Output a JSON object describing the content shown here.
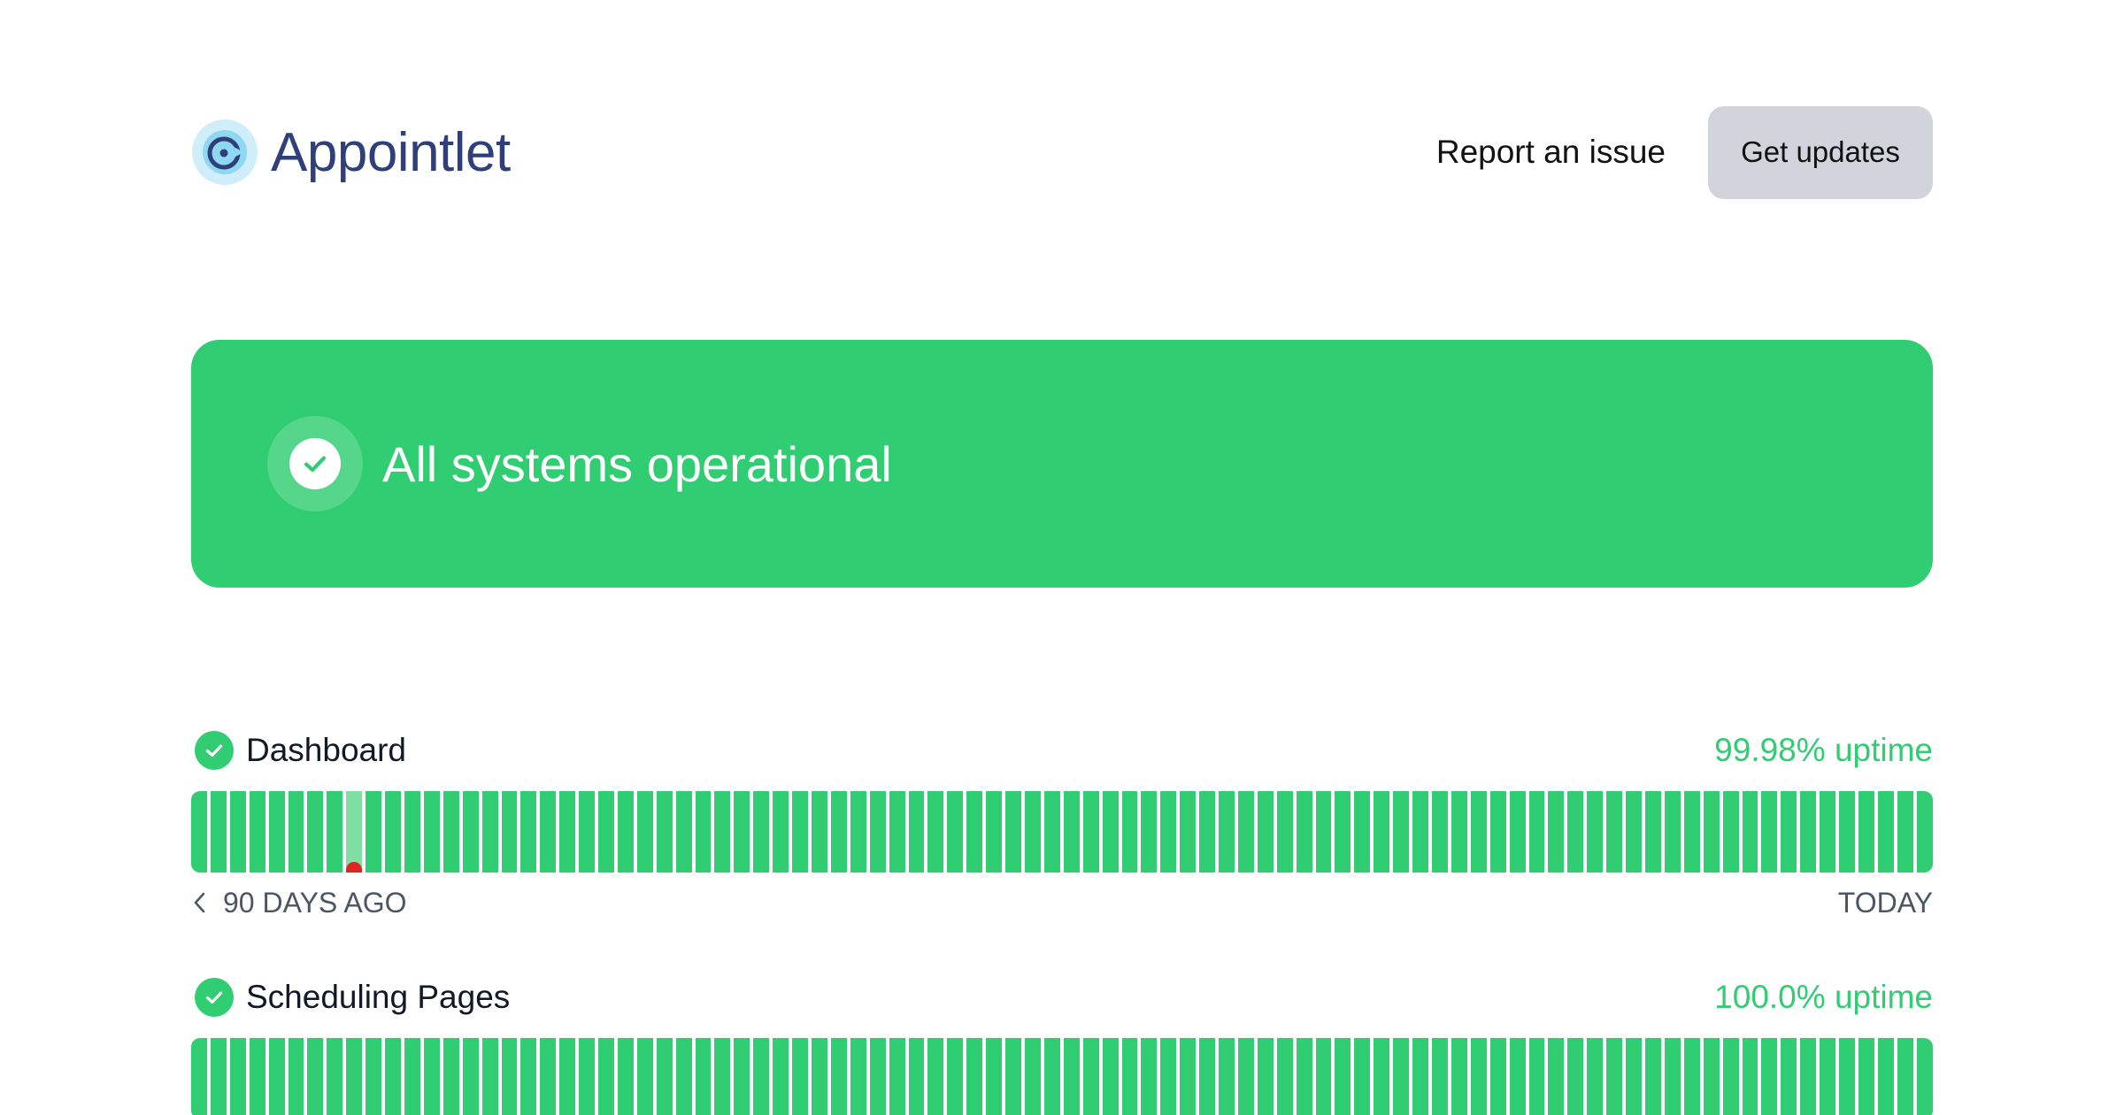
{
  "header": {
    "logo_text": "Appointlet",
    "report_label": "Report an issue",
    "updates_label": "Get updates"
  },
  "banner": {
    "status_text": "All systems operational",
    "color": "#30cd72"
  },
  "colors": {
    "operational": "#30cd72",
    "degraded": "#7fdea4",
    "outage_marker": "#dc2626",
    "button_bg": "#d1d5db",
    "brand_text": "#2f3f7a"
  },
  "components": [
    {
      "name": "Dashboard",
      "uptime": "99.98% uptime",
      "days": 90,
      "incident_days": [
        8
      ],
      "range_start": "90 DAYS AGO",
      "range_end": "TODAY"
    },
    {
      "name": "Scheduling Pages",
      "uptime": "100.0% uptime",
      "days": 90,
      "incident_days": []
    }
  ]
}
